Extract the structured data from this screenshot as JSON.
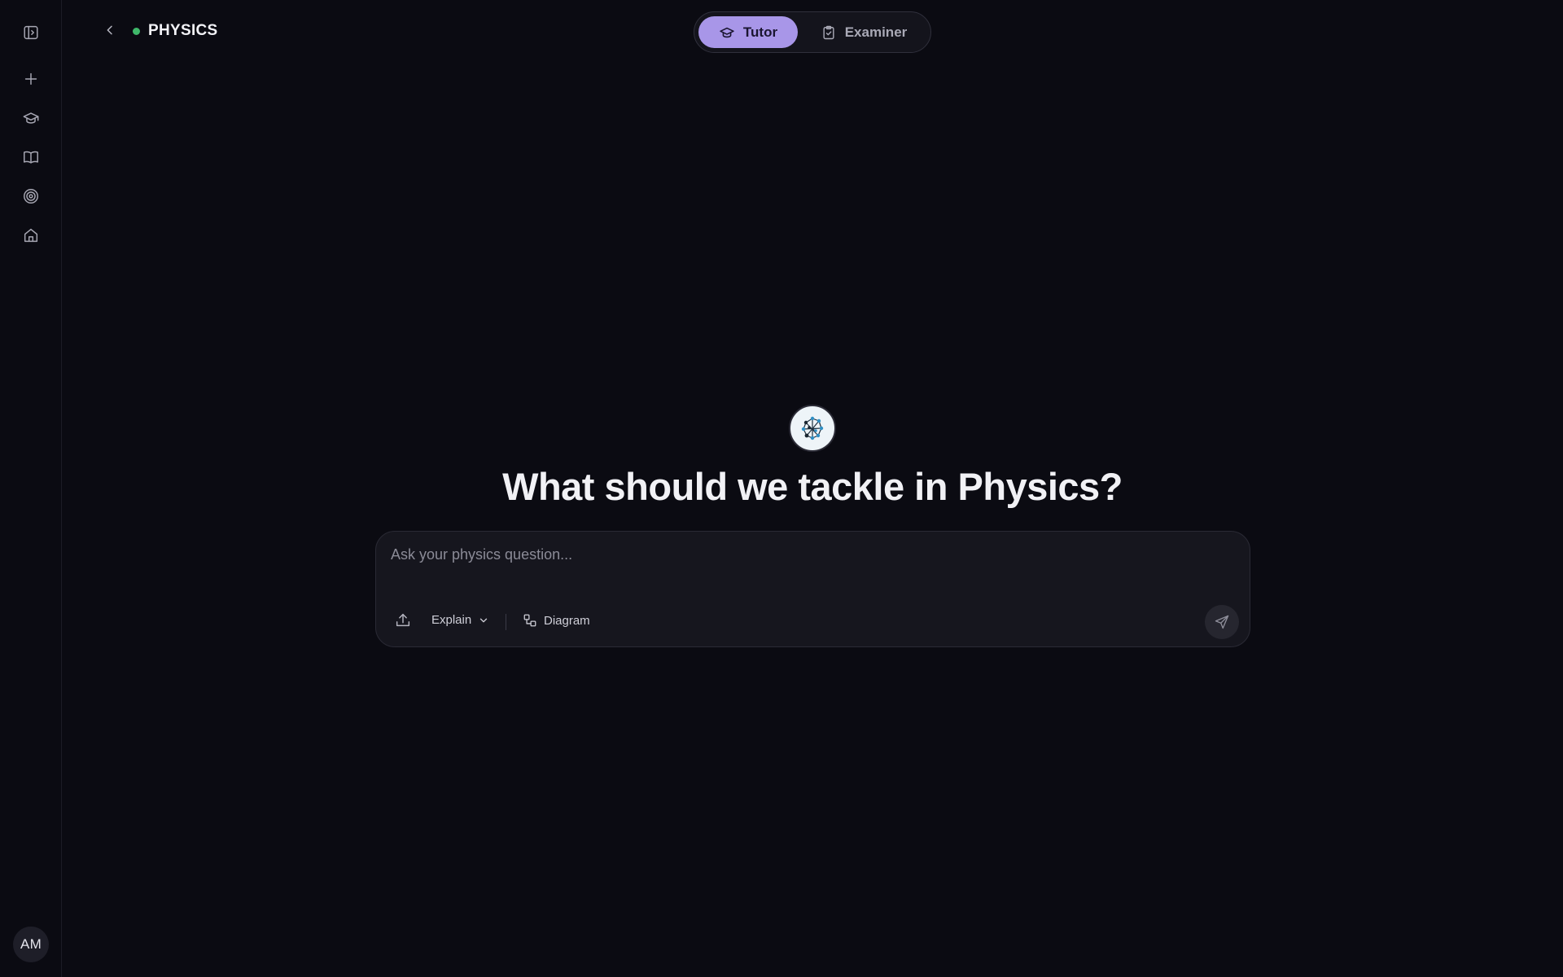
{
  "header": {
    "subject": "PHYSICS",
    "status_color": "#3fb86a"
  },
  "modes": [
    {
      "label": "Tutor",
      "icon": "graduation-cap-icon",
      "active": true
    },
    {
      "label": "Examiner",
      "icon": "clipboard-check-icon",
      "active": false
    }
  ],
  "sidebar": {
    "icons": [
      "sidebar-toggle-icon",
      "plus-icon",
      "graduation-cap-icon",
      "book-open-icon",
      "target-icon",
      "home-icon"
    ],
    "avatar_initials": "AM"
  },
  "main": {
    "headline": "What should we tackle in Physics?",
    "logo": "physics-network-logo-icon"
  },
  "composer": {
    "placeholder": "Ask your physics question...",
    "mode_label": "Explain",
    "diagram_label": "Diagram",
    "upload_icon": "upload-icon",
    "send_icon": "send-icon"
  },
  "colors": {
    "background": "#0b0b12",
    "accent": "#a896e8",
    "surface": "#16161e"
  }
}
